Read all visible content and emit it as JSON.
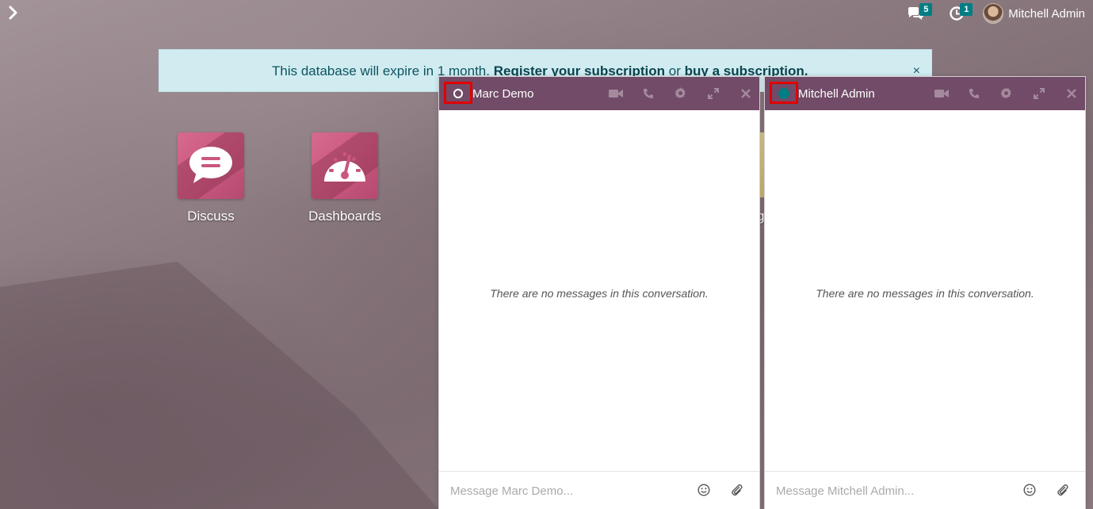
{
  "topbar": {
    "menu_icon": "chevron-right-icon",
    "messages_badge": "5",
    "activities_badge": "1",
    "user_name": "Mitchell Admin"
  },
  "banner": {
    "text_prefix": "This database will expire in 1 month.",
    "register_link": "Register your subscription",
    "or_text": "or",
    "buy_link": "buy a subscription.",
    "close": "×"
  },
  "apps": [
    {
      "label": "Discuss",
      "icon": "speech-bubble-icon"
    },
    {
      "label": "Dashboards",
      "icon": "speedometer-icon"
    }
  ],
  "partial_app_label": "g",
  "chats": [
    {
      "name": "Marc Demo",
      "status": "away",
      "empty_text": "There are no messages in this conversation.",
      "placeholder": "Message Marc Demo..."
    },
    {
      "name": "Mitchell Admin",
      "status": "online",
      "empty_text": "There are no messages in this conversation.",
      "placeholder": "Message Mitchell Admin..."
    }
  ],
  "colors": {
    "header": "#714b67",
    "accent": "#017e84",
    "banner_bg": "#d1ecf1",
    "highlight": "#e00000"
  }
}
